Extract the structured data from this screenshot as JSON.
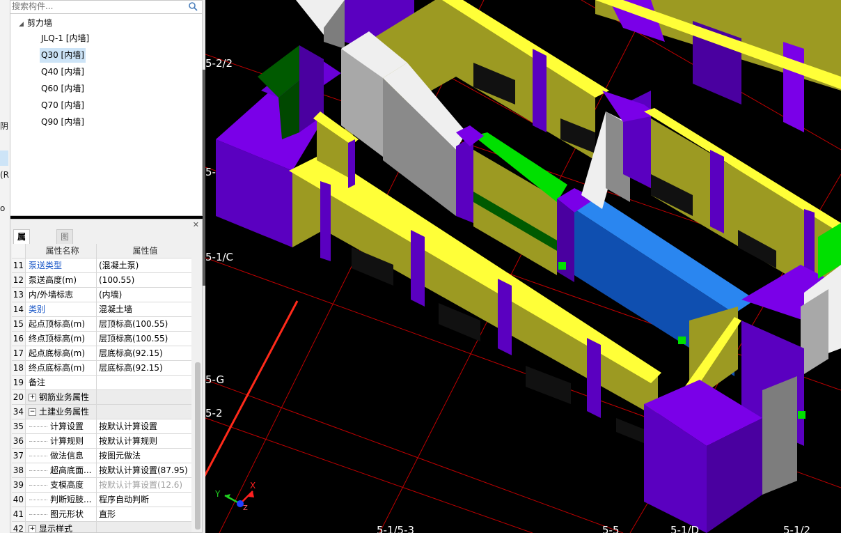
{
  "left_sliver": {
    "fragments": [
      "阴",
      "(R",
      "o"
    ]
  },
  "tree": {
    "search_placeholder": "搜索构件...",
    "root_label": "剪力墙",
    "items": [
      {
        "label": "JLQ-1 [内墙]"
      },
      {
        "label": "Q30 [内墙]",
        "selected": true
      },
      {
        "label": "Q40 [内墙]"
      },
      {
        "label": "Q60 [内墙]"
      },
      {
        "label": "Q70 [内墙]"
      },
      {
        "label": "Q90 [内墙]"
      }
    ]
  },
  "properties": {
    "tabs": [
      {
        "label": "属性列表",
        "active": true
      },
      {
        "label": "图层管理",
        "active": false
      }
    ],
    "header": {
      "name": "属性名称",
      "value": "属性值"
    },
    "rows": [
      {
        "num": "11",
        "name": "泵送类型",
        "value": "(混凝土泵)",
        "name_color": "blue"
      },
      {
        "num": "12",
        "name": "泵送高度(m)",
        "value": "(100.55)"
      },
      {
        "num": "13",
        "name": "内/外墙标志",
        "value": "(内墙)"
      },
      {
        "num": "14",
        "name": "类别",
        "value": "混凝土墙",
        "name_color": "blue"
      },
      {
        "num": "15",
        "name": "起点顶标高(m)",
        "value": "层顶标高(100.55)"
      },
      {
        "num": "16",
        "name": "终点顶标高(m)",
        "value": "层顶标高(100.55)"
      },
      {
        "num": "17",
        "name": "起点底标高(m)",
        "value": "层底标高(92.15)"
      },
      {
        "num": "18",
        "name": "终点底标高(m)",
        "value": "层底标高(92.15)"
      },
      {
        "num": "19",
        "name": "备注",
        "value": ""
      },
      {
        "num": "20",
        "name": "钢筋业务属性",
        "value": "",
        "group": true,
        "expander": "+"
      },
      {
        "num": "34",
        "name": "土建业务属性",
        "value": "",
        "group": true,
        "expander": "−"
      },
      {
        "num": "35",
        "name": "计算设置",
        "value": "按默认计算设置",
        "child": true
      },
      {
        "num": "36",
        "name": "计算规则",
        "value": "按默认计算规则",
        "child": true
      },
      {
        "num": "37",
        "name": "做法信息",
        "value": "按图元做法",
        "child": true
      },
      {
        "num": "38",
        "name": "超高底面...",
        "value": "按默认计算设置(87.95)",
        "child": true
      },
      {
        "num": "39",
        "name": "支模高度",
        "value": "按默认计算设置(12.6)",
        "child": true,
        "value_color": "gray"
      },
      {
        "num": "40",
        "name": "判断短肢...",
        "value": "程序自动判断",
        "child": true
      },
      {
        "num": "41",
        "name": "图元形状",
        "value": "直形",
        "child": true
      },
      {
        "num": "42",
        "name": "显示样式",
        "value": "",
        "group": true,
        "expander": "+"
      }
    ]
  },
  "viewport": {
    "axis_labels": [
      "5-2/2",
      "5-",
      "5-1/C",
      "5-G",
      "5-2",
      "5-1/5-3",
      "5-5",
      "5-1/D",
      "5-1/2"
    ],
    "gizmo": {
      "x_label": "X",
      "y_label": "Y",
      "z_label": "Z"
    },
    "colors": {
      "wall_olive": "#9c9a22",
      "wall_olive_dark": "#7a7818",
      "top_yellow": "#ffff38",
      "column_purple": "#7a00e8",
      "column_purple_dark": "#4a00a0",
      "selected_blue": "#0f4fb0",
      "selected_top": "#2a86f0",
      "green_band": "#00e000",
      "dark_green": "#005a00",
      "gray_wall": "#a8a8a8",
      "white_top": "#efefef",
      "grip_green": "#00e000",
      "arrow_red": "#ff2a1a",
      "grid_red": "#c00000"
    }
  }
}
